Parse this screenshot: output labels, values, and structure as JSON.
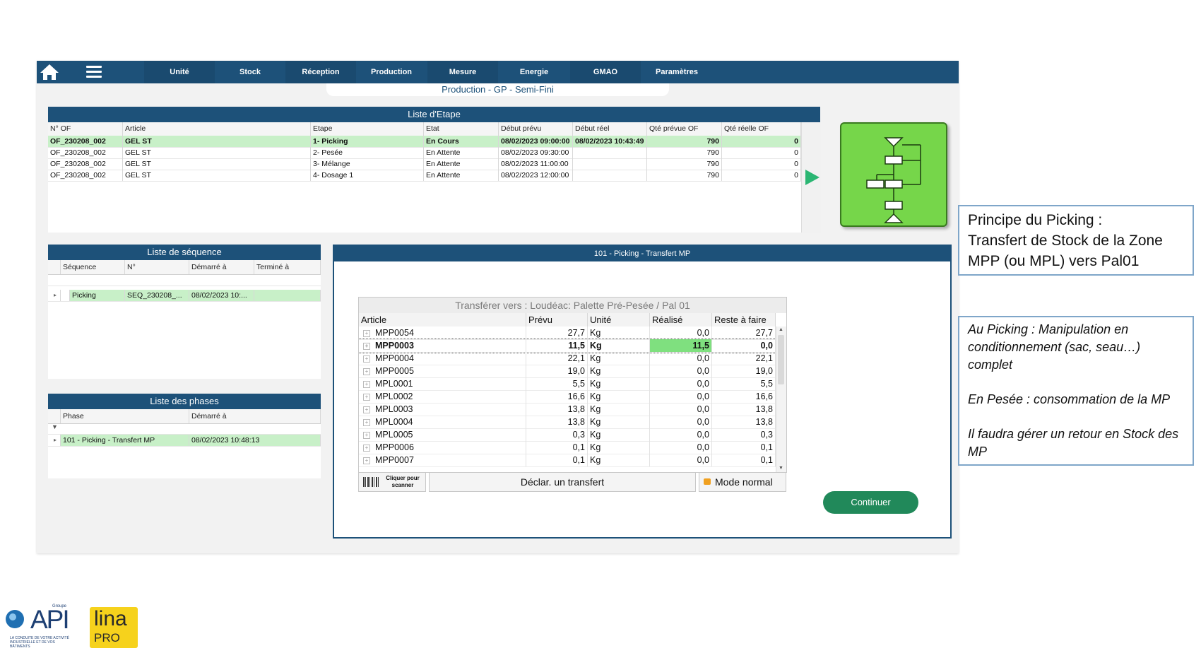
{
  "navbar": {
    "items": [
      "Unité",
      "Stock",
      "Réception",
      "Production",
      "Mesure",
      "Energie",
      "GMAO",
      "Paramètres"
    ]
  },
  "screen_title": "Production - GP - Semi-Fini",
  "etape": {
    "title": "Liste d'Etape",
    "columns": [
      "N° OF",
      "Article",
      "Etape",
      "Etat",
      "Début prévu",
      "Début réel",
      "Qté prévue OF",
      "Qté réelle OF"
    ],
    "rows": [
      {
        "of": "OF_230208_002",
        "article": "GEL ST",
        "etape": "1- Picking",
        "etat": "En Cours",
        "debut_prevu": "08/02/2023 09:00:00",
        "debut_reel": "08/02/2023 10:43:49",
        "qte_prevue": "790",
        "qte_reelle": "0"
      },
      {
        "of": "OF_230208_002",
        "article": "GEL ST",
        "etape": "2- Pesée",
        "etat": "En Attente",
        "debut_prevu": "08/02/2023 09:30:00",
        "debut_reel": "",
        "qte_prevue": "790",
        "qte_reelle": "0"
      },
      {
        "of": "OF_230208_002",
        "article": "GEL ST",
        "etape": "3- Mélange",
        "etat": "En Attente",
        "debut_prevu": "08/02/2023 11:00:00",
        "debut_reel": "",
        "qte_prevue": "790",
        "qte_reelle": "0"
      },
      {
        "of": "OF_230208_002",
        "article": "GEL ST",
        "etape": "4- Dosage 1",
        "etat": "En Attente",
        "debut_prevu": "08/02/2023 12:00:00",
        "debut_reel": "",
        "qte_prevue": "790",
        "qte_reelle": "0"
      }
    ]
  },
  "sequence": {
    "title": "Liste de séquence",
    "columns": [
      "Séquence",
      "N°",
      "Démarré à",
      "Terminé à"
    ],
    "row": {
      "sequence": "Picking",
      "numero": "SEQ_230208_...",
      "demarre": "08/02/2023 10:...",
      "termine": ""
    }
  },
  "phases": {
    "title": "Liste des phases",
    "columns": [
      "Phase",
      "Démarré à"
    ],
    "row": {
      "phase": "101 - Picking - Transfert MP",
      "demarre": "08/02/2023 10:48:13"
    }
  },
  "transfer": {
    "header": "101 - Picking - Transfert MP",
    "box_title": "Transférer vers : Loudéac: Palette Pré-Pesée / Pal 01",
    "columns": [
      "Article",
      "Prévu",
      "Unité",
      "Réalisé",
      "Reste à faire"
    ],
    "rows": [
      {
        "article": "MPP0054",
        "prevu": "27,7",
        "unite": "Kg",
        "realise": "0,0",
        "reste": "27,7"
      },
      {
        "article": "MPP0003",
        "prevu": "11,5",
        "unite": "Kg",
        "realise": "11,5",
        "reste": "0,0"
      },
      {
        "article": "MPP0004",
        "prevu": "22,1",
        "unite": "Kg",
        "realise": "0,0",
        "reste": "22,1"
      },
      {
        "article": "MPP0005",
        "prevu": "19,0",
        "unite": "Kg",
        "realise": "0,0",
        "reste": "19,0"
      },
      {
        "article": "MPL0001",
        "prevu": "5,5",
        "unite": "Kg",
        "realise": "0,0",
        "reste": "5,5"
      },
      {
        "article": "MPL0002",
        "prevu": "16,6",
        "unite": "Kg",
        "realise": "0,0",
        "reste": "16,6"
      },
      {
        "article": "MPL0003",
        "prevu": "13,8",
        "unite": "Kg",
        "realise": "0,0",
        "reste": "13,8"
      },
      {
        "article": "MPL0004",
        "prevu": "13,8",
        "unite": "Kg",
        "realise": "0,0",
        "reste": "13,8"
      },
      {
        "article": "MPL0005",
        "prevu": "0,3",
        "unite": "Kg",
        "realise": "0,0",
        "reste": "0,3"
      },
      {
        "article": "MPP0006",
        "prevu": "0,1",
        "unite": "Kg",
        "realise": "0,0",
        "reste": "0,1"
      },
      {
        "article": "MPP0007",
        "prevu": "0,1",
        "unite": "Kg",
        "realise": "0,0",
        "reste": "0,1"
      }
    ],
    "scan_label": "Cliquer pour scanner",
    "declare_label": "Déclar. un transfert",
    "mode_label": "Mode normal",
    "continue_label": "Continuer"
  },
  "callout1": {
    "lines": [
      "Principe du Picking :",
      "Transfert de Stock de la Zone",
      "MPP (ou MPL) vers Pal01"
    ]
  },
  "callout2": {
    "p1": "Au Picking : Manipulation en conditionnement (sac, seau…) complet",
    "p2": "En Pesée : consommation de la MP",
    "p3": "Il faudra gérer un retour en Stock des MP"
  },
  "logos": {
    "api_small": "Groupe",
    "api": "API",
    "api_tagline": "LA CONDUITE DE VOTRE ACTIVITÉ INDUSTRIELLE ET DE VOS BÂTIMENTS",
    "lina": "lina",
    "pro": "PRO"
  },
  "colors": {
    "nav": "#1d5179",
    "active_row": "#c8f0c8",
    "workflow_green": "#76d64a",
    "continue": "#21895a"
  }
}
